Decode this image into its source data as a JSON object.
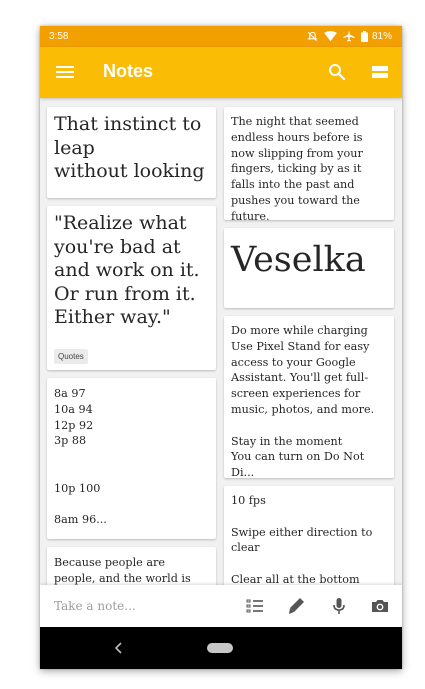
{
  "status_bar": {
    "time": "3:58",
    "battery": "81%",
    "icons": [
      "mute-icon",
      "wifi-icon",
      "airplane-icon",
      "battery-icon"
    ]
  },
  "app_bar": {
    "title": "Notes",
    "color": "#fbbc05",
    "icons": [
      "menu-icon",
      "search-icon",
      "view-toggle-icon"
    ]
  },
  "notes_left": [
    {
      "text": "That instinct to leap\nwithout looking",
      "style": "big"
    },
    {
      "text": "\"Realize what you're bad at and work on it. Or run from it. Either way.\"",
      "style": "big",
      "label": "Quotes"
    },
    {
      "text": "8a 97\n10a 94\n12p 92\n3p 88\n\n\n10p 100\n\n8am 96...",
      "style": "small"
    },
    {
      "text": "Because people are people, and the world is very often",
      "style": "small"
    }
  ],
  "notes_right": [
    {
      "text": "The night that seemed endless hours before is now slipping from your fingers, ticking by as it falls into the past and pushes you toward the future.",
      "style": "small"
    },
    {
      "text": "Veselka",
      "style": "huge"
    },
    {
      "text": "Do more while charging\nUse Pixel Stand for easy access to your Google Assistant. You'll get full-screen experiences for music, photos, and more.\n\nStay in the moment\nYou can turn on Do Not Di...",
      "style": "small"
    },
    {
      "text": "10 fps\n\nSwipe either direction to clear\n\nClear all at the bottom",
      "style": "small"
    }
  ],
  "bottom_bar": {
    "placeholder": "Take a note...",
    "icons": [
      "list-icon",
      "pen-icon",
      "microphone-icon",
      "camera-icon"
    ]
  },
  "nav_bar": {
    "icons": [
      "back-icon",
      "home-pill"
    ]
  }
}
